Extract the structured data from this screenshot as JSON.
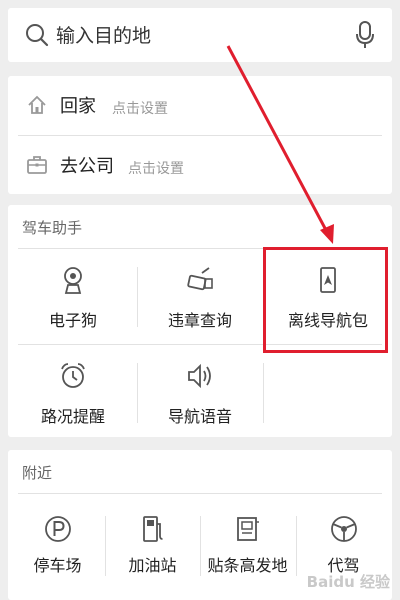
{
  "search": {
    "placeholder": "输入目的地"
  },
  "shortcuts": [
    {
      "label": "回家",
      "hint": "点击设置"
    },
    {
      "label": "去公司",
      "hint": "点击设置"
    }
  ],
  "driving_assistant": {
    "title": "驾车助手",
    "items": [
      {
        "label": "电子狗",
        "icon": "speed-camera-icon"
      },
      {
        "label": "违章查询",
        "icon": "traffic-violation-icon"
      },
      {
        "label": "离线导航包",
        "icon": "offline-map-icon",
        "highlighted": true
      },
      {
        "label": "路况提醒",
        "icon": "alarm-clock-icon"
      },
      {
        "label": "导航语音",
        "icon": "speaker-icon"
      }
    ]
  },
  "nearby": {
    "title": "附近",
    "items": [
      {
        "label": "停车场",
        "icon": "parking-icon"
      },
      {
        "label": "加油站",
        "icon": "gas-station-icon"
      },
      {
        "label": "贴条高发地",
        "icon": "ticket-icon"
      },
      {
        "label": "代驾",
        "icon": "steering-wheel-icon"
      }
    ]
  },
  "watermark": "Baidu 经验",
  "colors": {
    "highlight": "#e01e2e",
    "background": "#eeeeee"
  }
}
